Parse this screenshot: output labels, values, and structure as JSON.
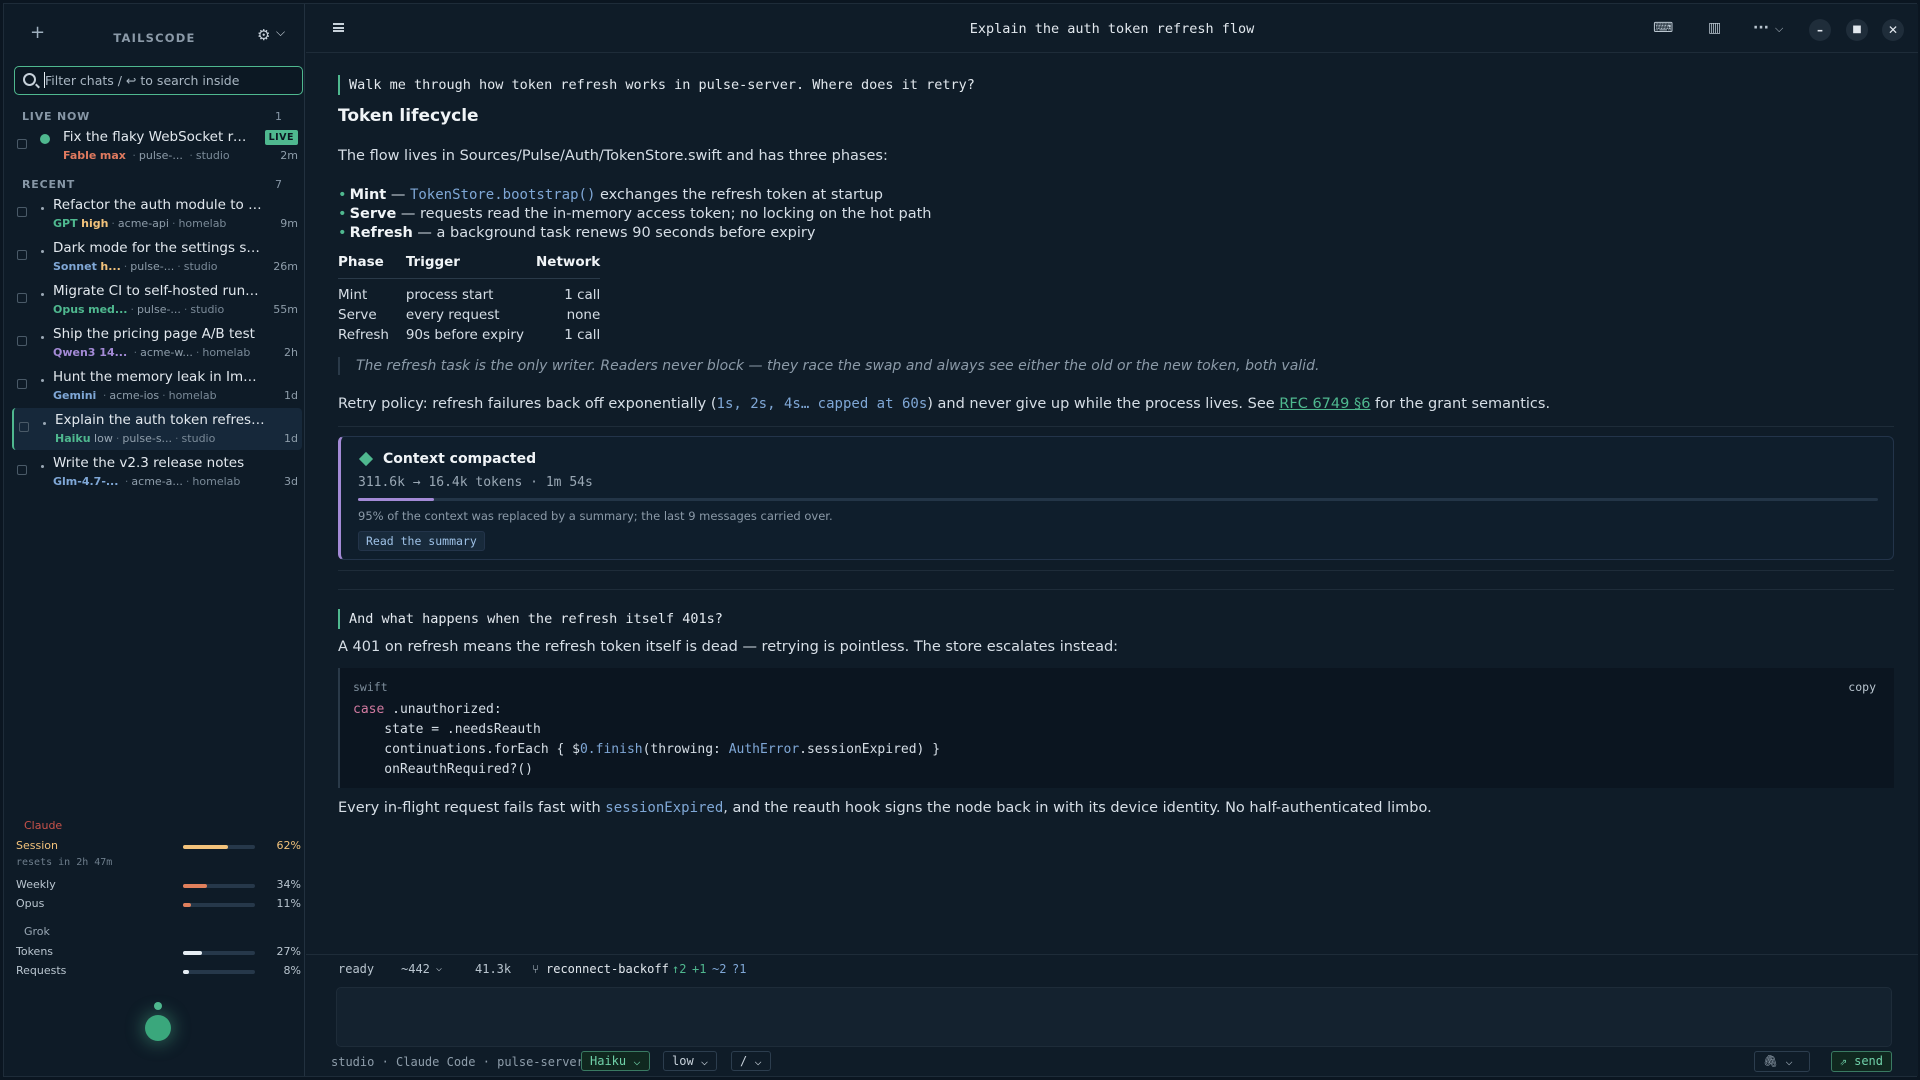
{
  "sidebar": {
    "title": "TAILSCODE",
    "search_placeholder": "Filter chats /  ↩ to search inside",
    "live": {
      "label": "LIVE NOW",
      "count": "1",
      "chat": {
        "title": "Fix the flaky WebSocket rec...",
        "badge": "LIVE",
        "model": "Fable",
        "effort": "max",
        "repo": "pulse-...",
        "host": "studio",
        "time": "2m"
      }
    },
    "recent": {
      "label": "RECENT",
      "count": "7",
      "chats": [
        {
          "title": "Refactor the auth module to async/a...",
          "model": "GPT",
          "effort": "high",
          "repo": "acme-api",
          "host": "homelab",
          "time": "9m"
        },
        {
          "title": "Dark mode for the settings screen",
          "model": "Sonnet",
          "effort": "h...",
          "repo": "pulse-...",
          "host": "studio",
          "time": "26m"
        },
        {
          "title": "Migrate CI to self-hosted runners",
          "model": "Opus",
          "effort": "med...",
          "repo": "pulse-...",
          "host": "studio",
          "time": "55m"
        },
        {
          "title": "Ship the pricing page A/B test",
          "model": "Qwen3 14...",
          "effort": "",
          "repo": "acme-w...",
          "host": "homelab",
          "time": "2h"
        },
        {
          "title": "Hunt the memory leak in ImagePipel...",
          "model": "Gemini",
          "effort": "",
          "repo": "acme-ios",
          "host": "homelab",
          "time": "1d"
        },
        {
          "title": "Explain the auth token refresh flow",
          "model": "Haiku",
          "effort": "low",
          "repo": "pulse-s...",
          "host": "studio",
          "time": "1d"
        },
        {
          "title": "Write the v2.3 release notes",
          "model": "Glm-4.7-...",
          "effort": "",
          "repo": "acme-a...",
          "host": "homelab",
          "time": "3d"
        }
      ]
    },
    "usage": {
      "claude": {
        "label": "Claude",
        "session": {
          "label": "Session",
          "pct": "62%",
          "value": 0.62,
          "sub": "resets in 2h 47m"
        },
        "weekly": {
          "label": "Weekly",
          "pct": "34%",
          "value": 0.34
        },
        "opus": {
          "label": "Opus",
          "pct": "11%",
          "value": 0.11
        }
      },
      "grok": {
        "label": "Grok",
        "tokens": {
          "label": "Tokens",
          "pct": "27%",
          "value": 0.27
        },
        "requests": {
          "label": "Requests",
          "pct": "8%",
          "value": 0.08
        }
      }
    }
  },
  "topbar": {
    "title": "Explain the auth token refresh flow"
  },
  "conversation": {
    "q1": "Walk me through how token refresh works in pulse-server. Where does it retry?",
    "h1": "Token lifecycle",
    "p1": "The flow lives in Sources/Pulse/Auth/TokenStore.swift and has three phases:",
    "bullets": [
      {
        "term": "Mint",
        "code": "TokenStore.bootstrap()",
        "rest": "exchanges the refresh token at startup"
      },
      {
        "term": "Serve",
        "code": "",
        "rest": "requests read the in-memory access token; no locking on the hot path"
      },
      {
        "term": "Refresh",
        "code": "",
        "rest": "a background task renews 90 seconds before expiry"
      }
    ],
    "table": {
      "headers": [
        "Phase",
        "Trigger",
        "Network"
      ],
      "rows": [
        [
          "Mint",
          "process start",
          "1 call"
        ],
        [
          "Serve",
          "every request",
          "none"
        ],
        [
          "Refresh",
          "90s before expiry",
          "1 call"
        ]
      ]
    },
    "quote": "The refresh task is the only writer. Readers never block — they race the swap and always see either the old or the new token, both valid.",
    "retry_pre": "Retry policy: refresh failures back off exponentially (",
    "retry_code": "1s, 2s, 4s… capped at 60s",
    "retry_mid": ") and never give up while the process lives. See ",
    "retry_link": "RFC 6749 §6",
    "retry_post": " for the grant semantics.",
    "compacted": {
      "title": "Context compacted",
      "stats": "311.6k → 16.4k tokens · 1m 54s",
      "progress": 0.05,
      "desc": "95% of the context was replaced by a summary; the last 9 messages carried over.",
      "button": "Read the summary"
    },
    "q2": "And what happens when the refresh itself 401s?",
    "p2": "A 401 on refresh means the refresh token itself is dead — retrying is pointless. The store escalates instead:",
    "code": {
      "lang": "swift",
      "copy": "copy",
      "l1_kw": "case",
      "l1_rest": " .unauthorized:",
      "l2": "    state = .needsReauth",
      "l3_a": "    continuations.forEach { $",
      "l3_b": "0.finish",
      "l3_c": "(throwing: ",
      "l3_d": "AuthError",
      "l3_e": ".sessionExpired) }",
      "l4": "    onReauthRequired?()"
    },
    "p3_pre": "Every in-flight request fails fast with ",
    "p3_code": "sessionExpired",
    "p3_post": ", and the reauth hook signs the node back in with its device identity. No half-authenticated limbo."
  },
  "statusbar": {
    "state": "ready",
    "lines": "~442",
    "tokens": "41.3k",
    "branch": "reconnect-backoff",
    "ahead": "↑2",
    "added": "+1",
    "removed": "~2",
    "untracked": "?1"
  },
  "footer": {
    "context": "studio · Claude Code · pulse-server",
    "model": "Haiku",
    "effort": "low",
    "slash": "/",
    "send": "send"
  },
  "colors": {
    "accent": "#4fb88f",
    "compact": "#a38ad6",
    "session_bar": "#f2c27b",
    "weekly_bar": "#e0805c",
    "grok_bar": "#e6edf3"
  }
}
